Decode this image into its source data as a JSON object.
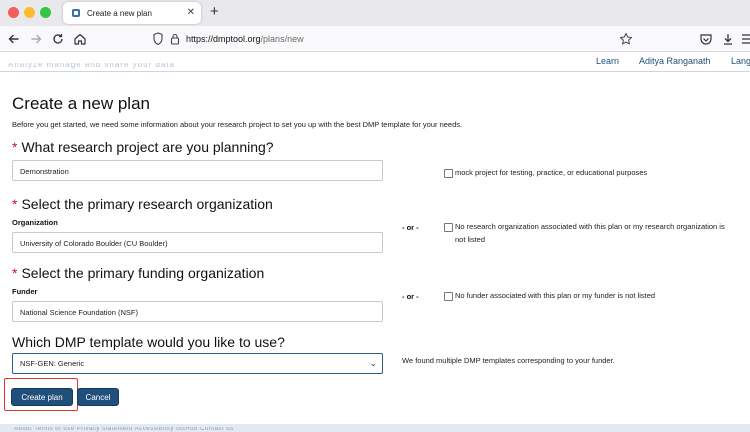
{
  "browser": {
    "tab_title": "Create a new plan",
    "url_domain": "https://dmptool.org",
    "url_path": "/plans/new"
  },
  "site_nav": {
    "faded_text": "Analyze manage and share your data",
    "links": [
      "Learn",
      "Aditya Ranganath",
      "Lang"
    ]
  },
  "page": {
    "title": "Create a new plan",
    "intro": "Before you get started, we need some information about your research project to set you up with the best DMP template for your needs."
  },
  "project": {
    "question": "What research project are you planning?",
    "value": "Demonstration",
    "mock_label": "mock project for testing, practice, or educational purposes"
  },
  "research_org": {
    "question": "Select the primary research organization",
    "sublabel": "Organization",
    "value": "University of Colorado Boulder (CU Boulder)",
    "or_label": "- or -",
    "none_label": "No research organization associated with this plan or my research organization is not listed"
  },
  "funding_org": {
    "question": "Select the primary funding organization",
    "sublabel": "Funder",
    "value": "National Science Foundation (NSF)",
    "or_label": "- or -",
    "none_label": "No funder associated with this plan or my funder is not listed"
  },
  "template": {
    "question": "Which DMP template would you like to use?",
    "selected": "NSF-GEN: Generic",
    "note": "We found multiple DMP templates corresponding to your funder."
  },
  "actions": {
    "create": "Create plan",
    "cancel": "Cancel"
  },
  "footer": {
    "faded_text": "About  Terms of use  Privacy statement  Accessibility  GitHub  Contact us"
  },
  "colors": {
    "primary": "#1f4f7a",
    "required": "#c8102e",
    "highlight": "#e0312c"
  }
}
